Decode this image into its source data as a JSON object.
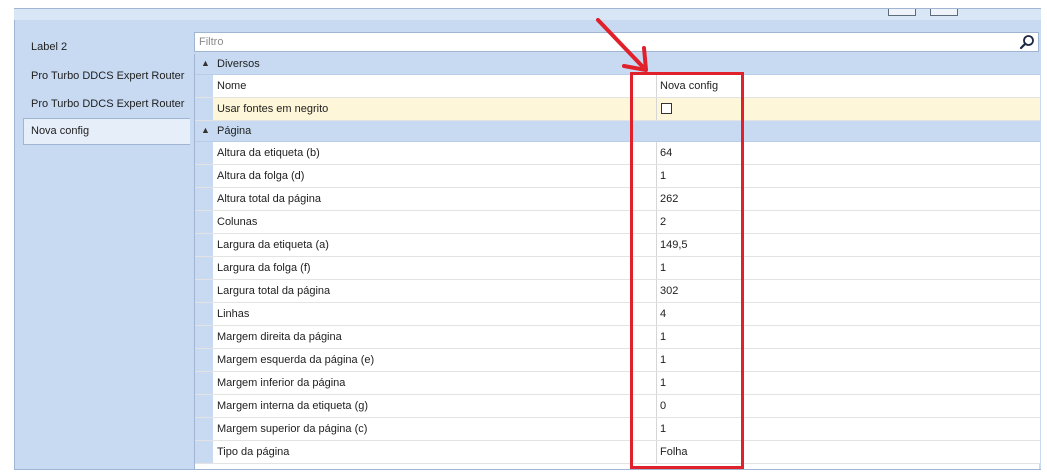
{
  "sidebar": {
    "items": [
      {
        "label": "Label 2"
      },
      {
        "label": "Pro Turbo DDCS Expert Router"
      },
      {
        "label": "Pro Turbo DDCS Expert Router"
      },
      {
        "label": "Nova config",
        "selected": true
      }
    ]
  },
  "filter": {
    "placeholder": "Filtro"
  },
  "grid": {
    "cat_diversos": "Diversos",
    "cat_pagina": "Página",
    "diversos": [
      {
        "name": "Nome",
        "value": "Nova config"
      },
      {
        "name": "Usar fontes em negrito",
        "checked": false
      }
    ],
    "pagina": [
      {
        "name": "Altura da etiqueta (b)",
        "value": "64"
      },
      {
        "name": "Altura da folga (d)",
        "value": "1"
      },
      {
        "name": "Altura total da página",
        "value": "262"
      },
      {
        "name": "Colunas",
        "value": "2"
      },
      {
        "name": "Largura da etiqueta (a)",
        "value": "149,5"
      },
      {
        "name": "Largura da folga (f)",
        "value": "1"
      },
      {
        "name": "Largura total da página",
        "value": "302"
      },
      {
        "name": "Linhas",
        "value": "4"
      },
      {
        "name": "Margem direita da página",
        "value": "1"
      },
      {
        "name": "Margem esquerda da página (e)",
        "value": "1"
      },
      {
        "name": "Margem inferior da página",
        "value": "1"
      },
      {
        "name": "Margem interna da etiqueta (g)",
        "value": "0"
      },
      {
        "name": "Margem superior da página (c)",
        "value": "1"
      },
      {
        "name": "Tipo da página",
        "value": "Folha"
      }
    ]
  },
  "colors": {
    "panel_bg": "#c7daf2",
    "highlight_row": "#fdf6d8",
    "annotation": "#e0202a"
  }
}
